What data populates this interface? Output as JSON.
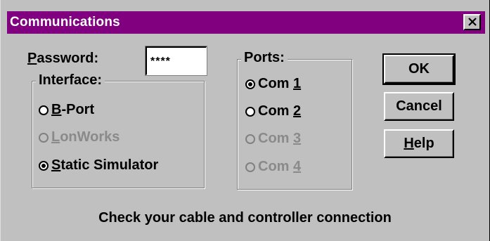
{
  "window": {
    "title": "Communications",
    "close_label": "Close"
  },
  "password": {
    "label_mnemonic": "P",
    "label_rest": "assword:",
    "value": "****"
  },
  "interface": {
    "group_label": "Interface:",
    "options": [
      {
        "mnemonic": "B",
        "rest": "-Port",
        "selected": false,
        "enabled": true
      },
      {
        "mnemonic": "L",
        "rest": "onWorks",
        "selected": false,
        "enabled": false
      },
      {
        "mnemonic": "S",
        "rest": "tatic Simulator",
        "selected": true,
        "enabled": true
      }
    ]
  },
  "ports": {
    "group_label": "Ports:",
    "options": [
      {
        "prefix": "Com ",
        "mnemonic": "1",
        "selected": true,
        "enabled": true
      },
      {
        "prefix": "Com ",
        "mnemonic": "2",
        "selected": false,
        "enabled": true
      },
      {
        "prefix": "Com ",
        "mnemonic": "3",
        "selected": false,
        "enabled": false
      },
      {
        "prefix": "Com ",
        "mnemonic": "4",
        "selected": false,
        "enabled": false
      }
    ]
  },
  "buttons": {
    "ok": "OK",
    "cancel": "Cancel",
    "help_mnemonic": "H",
    "help_rest": "elp"
  },
  "status": "Check your cable and controller connection",
  "colors": {
    "titlebar": "#800080",
    "face": "#c0c0c0",
    "disabled_text": "#8a8a8a"
  }
}
